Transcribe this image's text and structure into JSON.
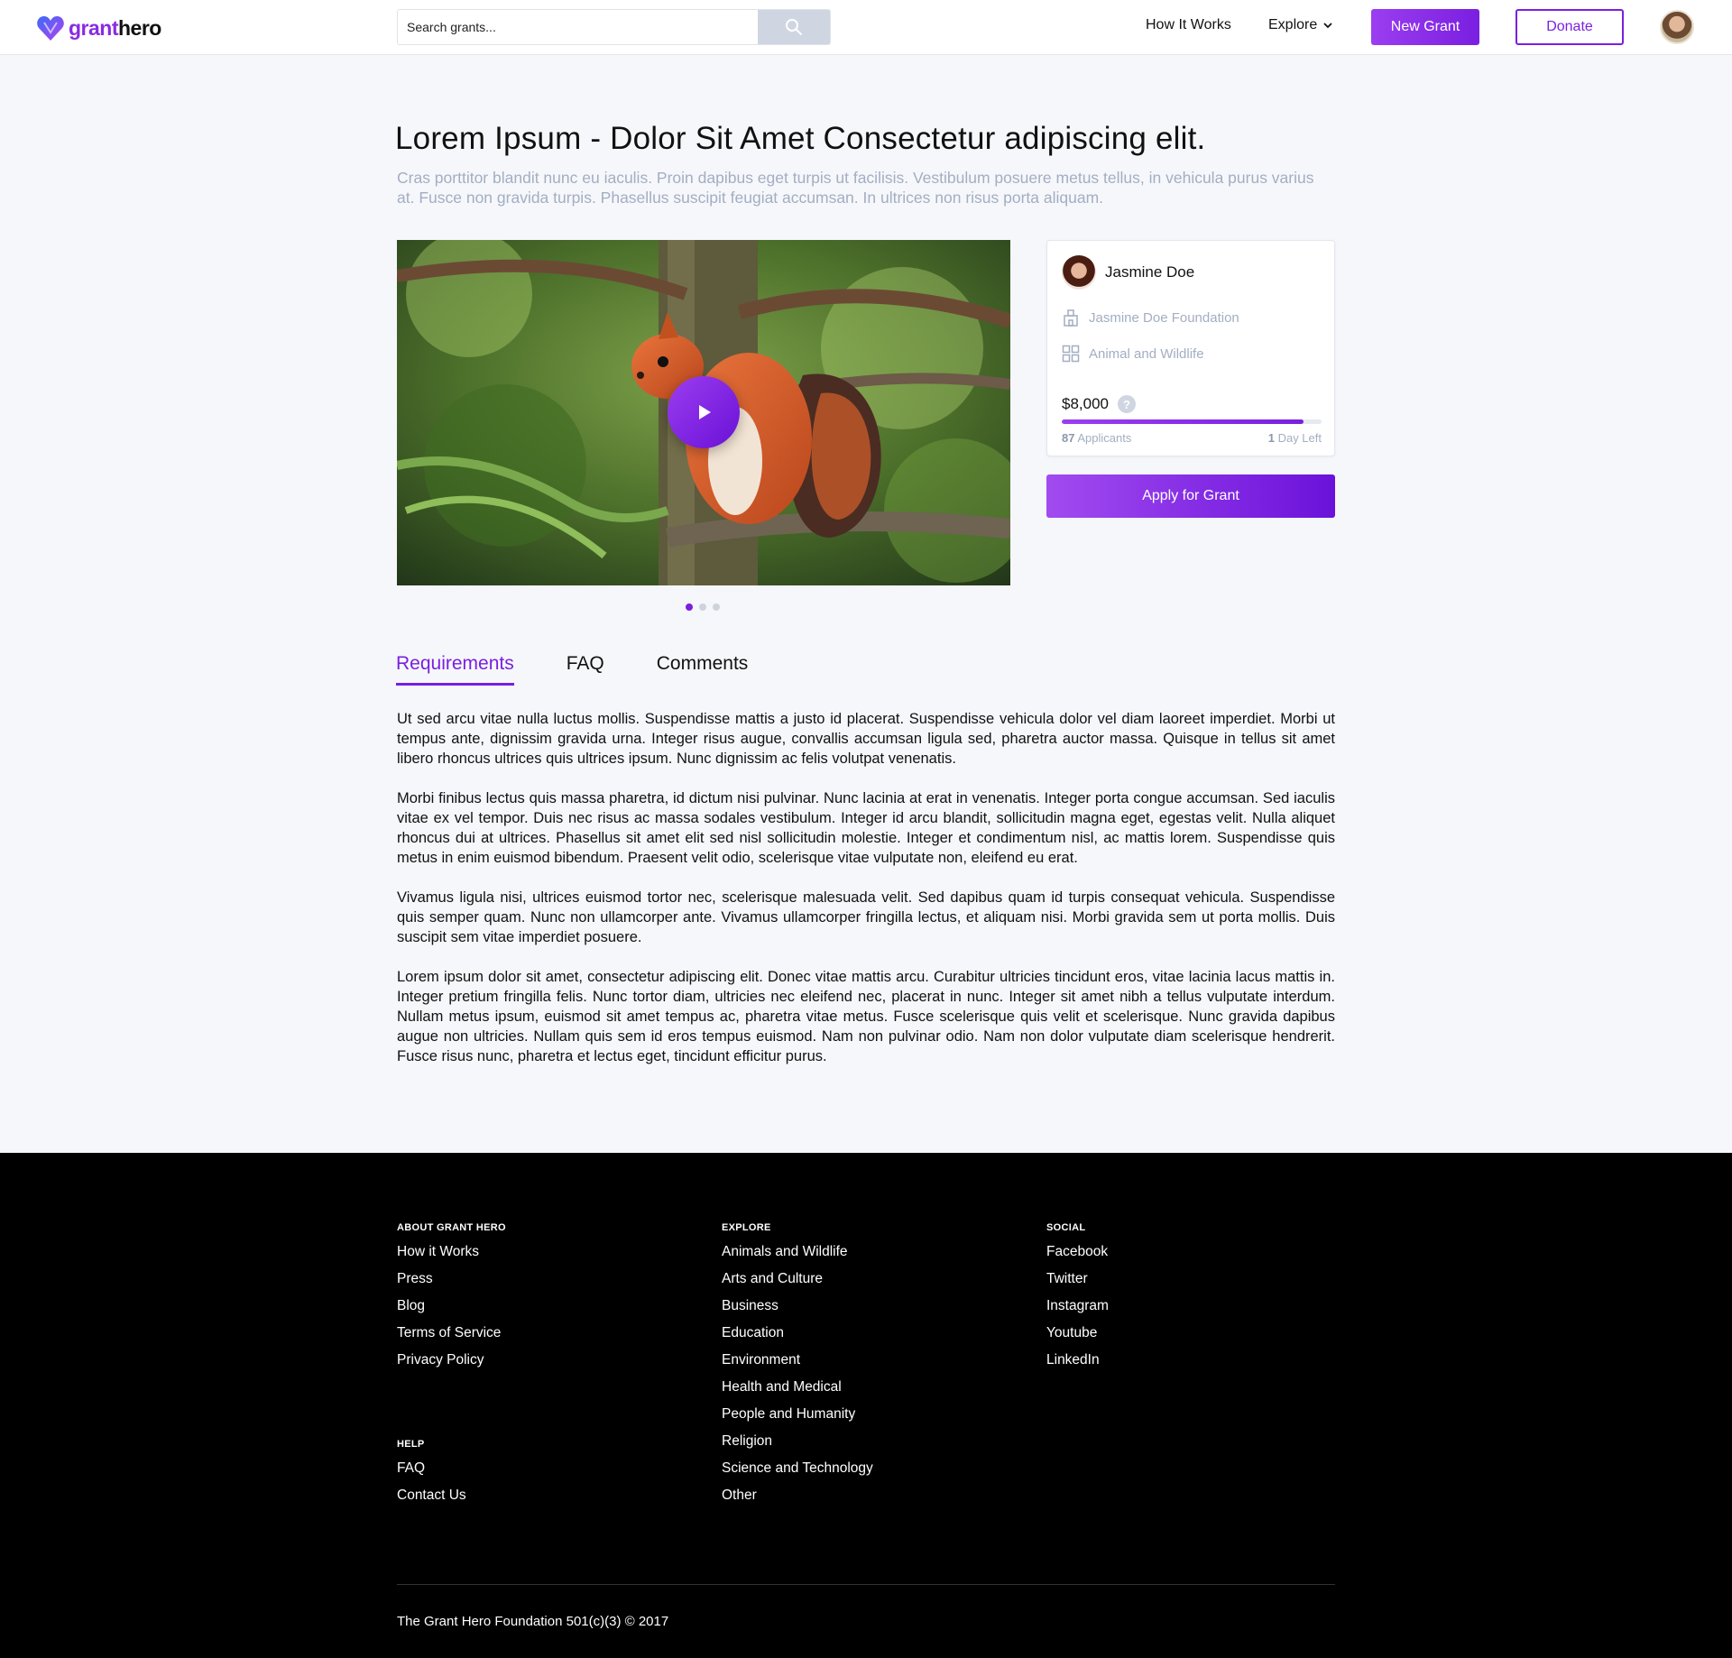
{
  "header": {
    "logo_grant": "grant",
    "logo_hero": "hero",
    "search_placeholder": "Search grants...",
    "nav_how": "How It Works",
    "nav_explore": "Explore",
    "new_grant": "New Grant",
    "donate": "Donate"
  },
  "grant": {
    "title": "Lorem Ipsum - Dolor Sit Amet Consectetur adipiscing elit.",
    "subtitle": "Cras porttitor blandit nunc eu iaculis. Proin dapibus eget turpis ut facilisis. Vestibulum posuere metus tellus, in vehicula purus varius at. Fusce non gravida turpis. Phasellus suscipit feugiat accumsan. In ultrices non risus porta aliquam."
  },
  "card": {
    "owner": "Jasmine Doe",
    "organization": "Jasmine Doe Foundation",
    "category": "Animal and Wildlife",
    "amount": "$8,000",
    "help": "?",
    "progress_fraction": 0.93,
    "applicants_count": "87",
    "applicants_label": "Applicants",
    "days_count": "1",
    "days_label": "Day Left"
  },
  "apply_button": "Apply for Grant",
  "tabs": [
    {
      "label": "Requirements",
      "active": true
    },
    {
      "label": "FAQ",
      "active": false
    },
    {
      "label": "Comments",
      "active": false
    }
  ],
  "body": {
    "p1": "Ut sed arcu vitae nulla luctus mollis. Suspendisse mattis a justo id placerat. Suspendisse vehicula dolor vel diam laoreet imperdiet. Morbi ut tempus ante, dignissim gravida urna. Integer risus augue, convallis accumsan ligula sed, pharetra auctor massa. Quisque in tellus sit amet libero rhoncus ultrices quis ultrices ipsum. Nunc dignissim ac felis volutpat venenatis.",
    "p2": "Morbi finibus lectus quis massa pharetra, id dictum nisi pulvinar. Nunc lacinia at erat in venenatis. Integer porta congue accumsan. Sed iaculis vitae ex vel tempor. Duis nec risus ac massa sodales vestibulum. Integer id arcu blandit, sollicitudin magna eget, egestas velit. Nulla aliquet rhoncus dui at ultrices. Phasellus sit amet elit sed nisl sollicitudin molestie. Integer et condimentum nisl, ac mattis lorem. Suspendisse quis metus in enim euismod bibendum. Praesent velit odio, scelerisque vitae vulputate non, eleifend eu erat.",
    "p3": "Vivamus ligula nisi, ultrices euismod tortor nec, scelerisque malesuada velit. Sed dapibus quam id turpis consequat vehicula. Suspendisse quis semper quam. Nunc non ullamcorper ante. Vivamus ullamcorper fringilla lectus, et aliquam nisi. Morbi gravida sem ut porta mollis. Duis suscipit sem vitae imperdiet posuere.",
    "p4": "Lorem ipsum dolor sit amet, consectetur adipiscing elit. Donec vitae mattis arcu. Curabitur ultricies tincidunt eros, vitae lacinia lacus mattis in. Integer pretium fringilla felis. Nunc tortor diam, ultricies nec eleifend nec, placerat in nunc. Integer sit amet nibh a tellus vulputate interdum. Nullam metus ipsum, euismod sit amet tempus ac, pharetra vitae metus. Fusce scelerisque quis velit et scelerisque. Nunc gravida dapibus augue non ultricies. Nullam quis sem id eros tempus euismod. Nam non pulvinar odio. Nam non dolor vulputate diam scelerisque hendrerit. Fusce risus nunc, pharetra et lectus eget, tincidunt efficitur purus."
  },
  "footer": {
    "about_heading": "ABOUT GRANT HERO",
    "about_links": [
      "How it Works",
      "Press",
      "Blog",
      "Terms of Service",
      "Privacy Policy"
    ],
    "help_heading": "HELP",
    "help_links": [
      "FAQ",
      "Contact Us"
    ],
    "explore_heading": "EXPLORE",
    "explore_links": [
      "Animals and Wildlife",
      "Arts and Culture",
      "Business",
      "Education",
      "Environment",
      "Health and Medical",
      "People and Humanity",
      "Religion",
      "Science and Technology",
      "Other"
    ],
    "social_heading": "SOCIAL",
    "social_links": [
      "Facebook",
      "Twitter",
      "Instagram",
      "Youtube",
      "LinkedIn"
    ],
    "copyright": "The Grant Hero Foundation 501(c)(3) © 2017"
  },
  "colors": {
    "accent": "#7a1fe0",
    "muted": "#a3aec2",
    "footer_bg": "#000000",
    "page_bg": "#f6f7fb"
  },
  "icons": {
    "search": "search-icon",
    "explore_dropdown": "chevron-down-icon",
    "organization": "building-icon",
    "category": "grid-icon",
    "play": "play-icon",
    "help": "help-icon"
  }
}
